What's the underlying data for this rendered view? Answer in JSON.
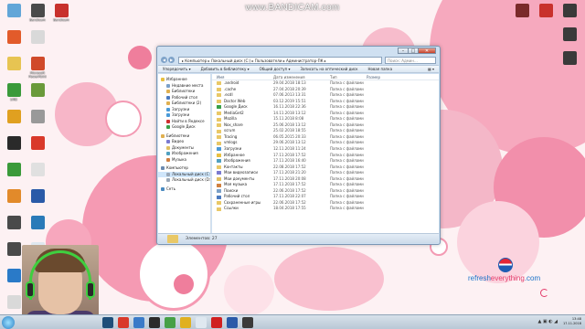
{
  "watermark": "www.BANDICAM.com",
  "colors": {
    "wall_pink": "#f49db4",
    "wall_pink_dark": "#e9658c",
    "accent_blue": "#1a72c8",
    "folder": "#e9c867"
  },
  "desktop_icons_left": [
    {
      "label": "",
      "color": "#62a6d8"
    },
    {
      "label": "Bandicam",
      "color": "#4a4a4a"
    },
    {
      "label": "Bandicam",
      "color": "#c8312c"
    },
    {
      "label": "",
      "color": "#e25b2a"
    },
    {
      "label": "",
      "color": "#d9d9d9"
    },
    {
      "label": "",
      "color": "#e7c452"
    },
    {
      "label": "Microsoft PowerPoint",
      "color": "#d04a2a"
    },
    {
      "label": "LINE",
      "color": "#3a9a3a"
    },
    {
      "label": "",
      "color": "#6a9a3a"
    },
    {
      "label": "",
      "color": "#e0a020"
    },
    {
      "label": "",
      "color": "#999999"
    },
    {
      "label": "",
      "color": "#2a2a2a"
    },
    {
      "label": "",
      "color": "#d9392a"
    },
    {
      "label": "",
      "color": "#3a9a3a"
    },
    {
      "label": "",
      "color": "#e0e0e0"
    },
    {
      "label": "",
      "color": "#e28a2a"
    },
    {
      "label": "",
      "color": "#2a5aa8"
    },
    {
      "label": "",
      "color": "#4a4a4a"
    },
    {
      "label": "",
      "color": "#2a7ab8"
    },
    {
      "label": "",
      "color": "#4a4a4a"
    },
    {
      "label": "",
      "color": "#dfe8f0"
    },
    {
      "label": "",
      "color": "#2a7ac8"
    },
    {
      "label": "",
      "color": "#dfe8f0"
    },
    {
      "label": "",
      "color": "#d9d9d9"
    },
    {
      "label": "",
      "color": "#e04040"
    },
    {
      "label": "Microsoft Word",
      "color": "#2a5aa8"
    }
  ],
  "desktop_icons_right": [
    {
      "label": "",
      "color": "#7a2a2a"
    },
    {
      "label": "",
      "color": "#c8312c"
    },
    {
      "label": "",
      "color": "#3a3a3a"
    },
    {
      "label": "",
      "color": "#3a3a3a"
    },
    {
      "label": "",
      "color": "#3a3a3a"
    }
  ],
  "brand": {
    "pre": "refresh",
    "mid": "everything",
    "post": ".com"
  },
  "explorer": {
    "address": "▸ Компьютер ▸ Локальный диск (C:) ▸ Пользователи ▸ Администратор-ПК ▸",
    "search_placeholder": "Поиск: Админ...",
    "toolbar": [
      "Упорядочить ▾",
      "Добавить в библиотеку ▾",
      "Общий доступ ▾",
      "Записать на оптический диск",
      "Новая папка"
    ],
    "view_label": "▦ ▾",
    "nav": [
      {
        "label": "Избранное",
        "level": 0,
        "color": "#e8c040"
      },
      {
        "label": "Недавние места",
        "level": 1,
        "color": "#7aa0c8"
      },
      {
        "label": "Библиотеки",
        "level": 1,
        "color": "#e0b050"
      },
      {
        "label": "Рабочий стол",
        "level": 1,
        "color": "#4a7ac0"
      },
      {
        "label": "Библиотеки (2)",
        "level": 1,
        "color": "#e0b050"
      },
      {
        "label": "Загрузки",
        "level": 1,
        "color": "#4a9ad8"
      },
      {
        "label": "Загрузки",
        "level": 1,
        "color": "#4a9ad8"
      },
      {
        "label": "Найти в Яндексе",
        "level": 1,
        "color": "#d03030"
      },
      {
        "label": "Google Диск",
        "level": 1,
        "color": "#38a048"
      },
      {
        "label": "",
        "level": -1
      },
      {
        "label": "Библиотеки",
        "level": 0,
        "color": "#e0b050"
      },
      {
        "label": "Видео",
        "level": 1,
        "color": "#7a7ad0"
      },
      {
        "label": "Документы",
        "level": 1,
        "color": "#e0c060"
      },
      {
        "label": "Изображения",
        "level": 1,
        "color": "#50a0c0"
      },
      {
        "label": "Музыка",
        "level": 1,
        "color": "#d08040"
      },
      {
        "label": "",
        "level": -1
      },
      {
        "label": "Компьютер",
        "level": 0,
        "color": "#6a8ab0"
      },
      {
        "label": "Локальный диск (C:)",
        "level": 1,
        "color": "#9aa8b8",
        "selected": true
      },
      {
        "label": "Локальный диск (D:)",
        "level": 1,
        "color": "#9aa8b8"
      },
      {
        "label": "",
        "level": -1
      },
      {
        "label": "Сеть",
        "level": 0,
        "color": "#4a8ac0"
      }
    ],
    "columns": [
      "Имя",
      "Дата изменения",
      "Тип",
      "Размер"
    ],
    "files": [
      {
        "name": ".android",
        "date": "29.04.2018 18:13",
        "type": "Папка с файлами",
        "color": "#e9c867"
      },
      {
        "name": ".cache",
        "date": "27.04.2018 20:39",
        "type": "Папка с файлами",
        "color": "#e9c867"
      },
      {
        "name": ".ecdl",
        "date": "07.06.2013 13:31",
        "type": "Папка с файлами",
        "color": "#e9c867"
      },
      {
        "name": "Doctor Web",
        "date": "03.12.2019 15:51",
        "type": "Папка с файлами",
        "color": "#e9c867"
      },
      {
        "name": "Google Диск",
        "date": "16.11.2018 22:36",
        "type": "Папка с файлами",
        "color": "#38a048"
      },
      {
        "name": "MediaGet2",
        "date": "14.11.2018 13:12",
        "type": "Папка с файлами",
        "color": "#e9c867"
      },
      {
        "name": "Mozilla",
        "date": "15.11.2018 8:08",
        "type": "Папка с файлами",
        "color": "#e9c867"
      },
      {
        "name": "Nox_share",
        "date": "25.06.2018 13:12",
        "type": "Папка с файлами",
        "color": "#e9c867"
      },
      {
        "name": "scrum",
        "date": "25.02.2018 18:55",
        "type": "Папка с файлами",
        "color": "#e9c867"
      },
      {
        "name": "Tracing",
        "date": "06.05.2015 20:33",
        "type": "Папка с файлами",
        "color": "#e9c867"
      },
      {
        "name": "vmlogs",
        "date": "29.06.2018 13:12",
        "type": "Папка с файлами",
        "color": "#e9c867"
      },
      {
        "name": "Загрузки",
        "date": "12.11.2018 11:24",
        "type": "Папка с файлами",
        "color": "#4a9ad8"
      },
      {
        "name": "Избранное",
        "date": "17.11.2018 17:52",
        "type": "Папка с файлами",
        "color": "#e8c040"
      },
      {
        "name": "Изображения",
        "date": "17.11.2018 16:40",
        "type": "Папка с файлами",
        "color": "#50a0c0"
      },
      {
        "name": "Контакты",
        "date": "22.08.2018 17:52",
        "type": "Папка с файлами",
        "color": "#e9c867"
      },
      {
        "name": "Мои видеозаписи",
        "date": "17.11.2018 21:20",
        "type": "Папка с файлами",
        "color": "#7a7ad0"
      },
      {
        "name": "Мои документы",
        "date": "17.11.2018 20:08",
        "type": "Папка с файлами",
        "color": "#e0c060"
      },
      {
        "name": "Моя музыка",
        "date": "17.11.2018 17:52",
        "type": "Папка с файлами",
        "color": "#d08040"
      },
      {
        "name": "Поиски",
        "date": "22.06.2018 17:52",
        "type": "Папка с файлами",
        "color": "#7aa0c8"
      },
      {
        "name": "Рабочий стол",
        "date": "17.11.2018 22:07",
        "type": "Папка с файлами",
        "color": "#4a7ac0"
      },
      {
        "name": "Сохраненные игры",
        "date": "22.06.2018 17:52",
        "type": "Папка с файлами",
        "color": "#e9c867"
      },
      {
        "name": "Ссылки",
        "date": "18.04.2018 17:55",
        "type": "Папка с файлами",
        "color": "#e9c867"
      }
    ],
    "status": "Элементов: 27"
  },
  "taskbar": {
    "apps": [
      "#1f4e79",
      "#d9392a",
      "#3a7ac8",
      "#2a2a2a",
      "#46a046",
      "#e0b020",
      "#dfe8f0",
      "#d02020",
      "#2a5aa8",
      "#3a3a3a"
    ],
    "tray_icons": "▲ ▣ ◐ ◢",
    "time": "13:48",
    "date": "17.11.2018"
  }
}
